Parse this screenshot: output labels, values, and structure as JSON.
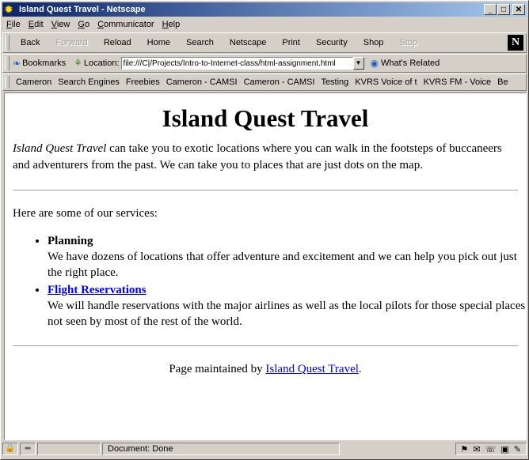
{
  "window": {
    "title": "Island Quest Travel - Netscape"
  },
  "menu": [
    {
      "label": "File",
      "u": "F",
      "rest": "ile"
    },
    {
      "label": "Edit",
      "u": "E",
      "rest": "dit"
    },
    {
      "label": "View",
      "u": "V",
      "rest": "iew"
    },
    {
      "label": "Go",
      "u": "G",
      "rest": "o"
    },
    {
      "label": "Communicator",
      "u": "C",
      "rest": "ommunicator"
    },
    {
      "label": "Help",
      "u": "H",
      "rest": "elp"
    }
  ],
  "nav": {
    "back": "Back",
    "forward": "Forward",
    "reload": "Reload",
    "home": "Home",
    "search": "Search",
    "netscape": "Netscape",
    "print": "Print",
    "security": "Security",
    "shop": "Shop",
    "stop": "Stop",
    "logo": "N"
  },
  "location": {
    "bookmarks": "Bookmarks",
    "label": "Location:",
    "url": "file:///C|/Projects/Intro-to-Internet-class/html-assignment.html",
    "related": "What's Related"
  },
  "personal": [
    "Cameron",
    "Search Engines",
    "Freebies",
    "Cameron - CAMSI",
    "Cameron - CAMSI",
    "Testing",
    "KVRS Voice of t",
    "KVRS FM - Voice",
    "Be"
  ],
  "page": {
    "heading": "Island Quest Travel",
    "intro_em": "Island Quest Travel",
    "intro_rest": " can take you to exotic locations where you can walk in the footsteps of buccaneers and adventurers from the past. We can take you to places that are just dots on the map.",
    "services_intro": "Here are some of our services:",
    "services": [
      {
        "title": "Planning",
        "desc": "We have dozens of locations that offer adventure and excitement and we can help you pick out just the right place."
      },
      {
        "title": "Flight Reservations",
        "desc": "We will handle reservations with the major airlines as well as the local pilots for those special places not seen by most of the rest of the world."
      }
    ],
    "footer_text": "Page maintained by ",
    "footer_link": "Island Quest Travel",
    "footer_end": "."
  },
  "status": {
    "text": "Document: Done"
  }
}
